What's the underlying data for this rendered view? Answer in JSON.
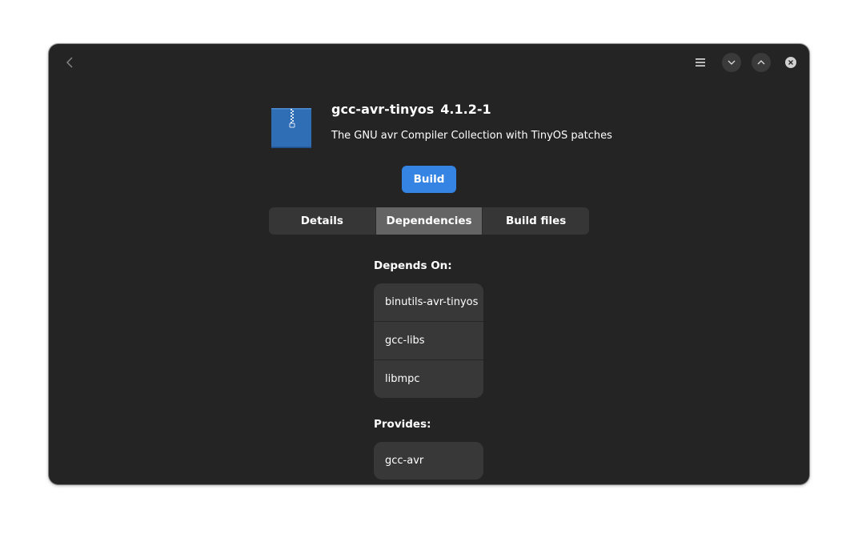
{
  "window": {
    "accent_color": "#3584e4",
    "background_color": "#242424"
  },
  "headerbar": {
    "back_icon": "chevron-left-icon",
    "menu_icon": "hamburger-menu-icon",
    "minimize_icon": "chevron-down-icon",
    "maximize_icon": "chevron-up-icon",
    "close_icon": "close-icon"
  },
  "package": {
    "icon": "archive-icon",
    "name": "gcc-avr-tinyos",
    "version": "4.1.2-1",
    "description": "The GNU avr Compiler Collection with TinyOS patches"
  },
  "actions": {
    "build_label": "Build"
  },
  "tabs": [
    {
      "label": "Details",
      "active": false
    },
    {
      "label": "Dependencies",
      "active": true
    },
    {
      "label": "Build files",
      "active": false
    }
  ],
  "dependencies": {
    "depends_on_label": "Depends On:",
    "depends_on": [
      "binutils-avr-tinyos",
      "gcc-libs",
      "libmpc"
    ],
    "provides_label": "Provides:",
    "provides": [
      "gcc-avr"
    ]
  }
}
